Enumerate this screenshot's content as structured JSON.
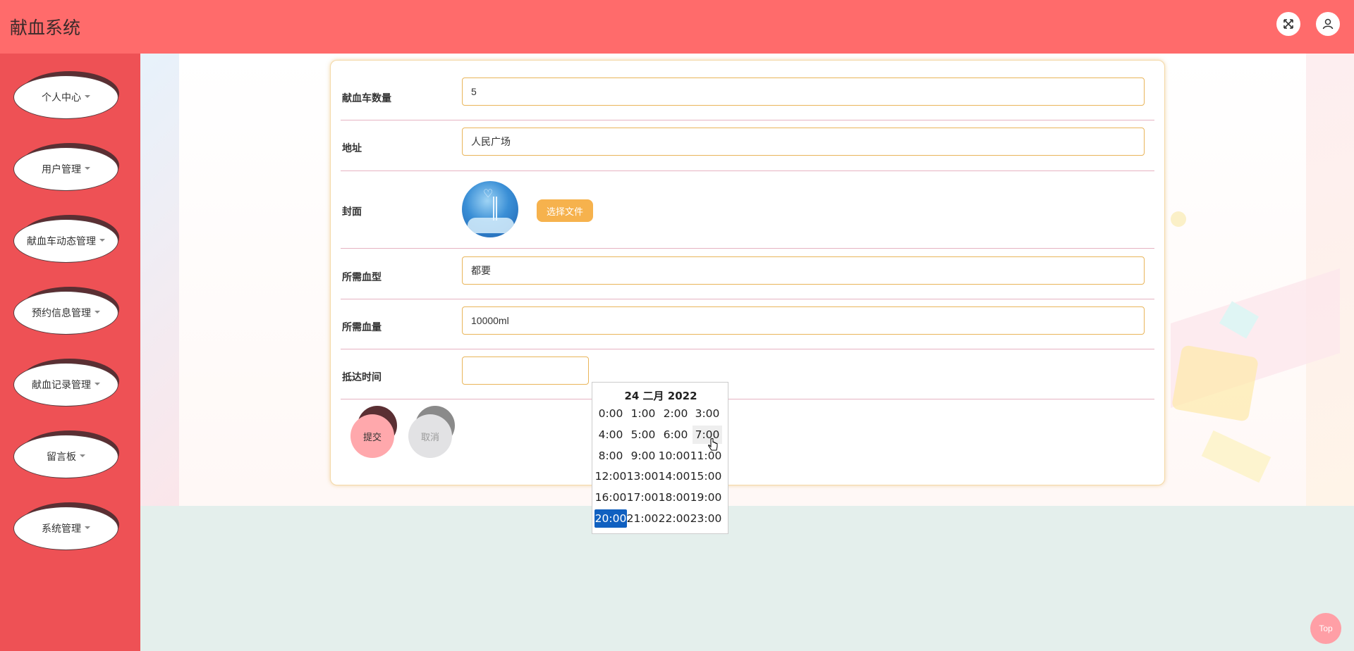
{
  "header": {
    "title": "献血系统",
    "fullscreen_icon": "expand-icon",
    "user_icon": "user-icon"
  },
  "sidebar": {
    "items": [
      {
        "label": "个人中心"
      },
      {
        "label": "用户管理"
      },
      {
        "label": "献血车动态管理"
      },
      {
        "label": "预约信息管理"
      },
      {
        "label": "献血记录管理"
      },
      {
        "label": "留言板"
      },
      {
        "label": "系统管理"
      }
    ]
  },
  "form": {
    "fields": [
      {
        "label": "献血车数量",
        "value": "5"
      },
      {
        "label": "地址",
        "value": "人民广场"
      },
      {
        "label": "封面"
      },
      {
        "label": "所需血型",
        "value": "都要"
      },
      {
        "label": "所需血量",
        "value": "10000ml"
      },
      {
        "label": "抵达时间",
        "value": ""
      }
    ],
    "file_button": "选择文件",
    "submit": "提交",
    "cancel": "取消"
  },
  "datepicker": {
    "title": "24 二月 2022",
    "hours": [
      "0:00",
      "1:00",
      "2:00",
      "3:00",
      "4:00",
      "5:00",
      "6:00",
      "7:00",
      "8:00",
      "9:00",
      "10:00",
      "11:00",
      "12:00",
      "13:00",
      "14:00",
      "15:00",
      "16:00",
      "17:00",
      "18:00",
      "19:00",
      "20:00",
      "21:00",
      "22:00",
      "23:00"
    ],
    "hovered": "7:00",
    "selected": "20:00"
  },
  "top_button": "Top",
  "colors": {
    "header": "#ff6b6b",
    "sidebar": "#ee5155",
    "accent": "#f6b24d",
    "selected": "#1060c0"
  }
}
